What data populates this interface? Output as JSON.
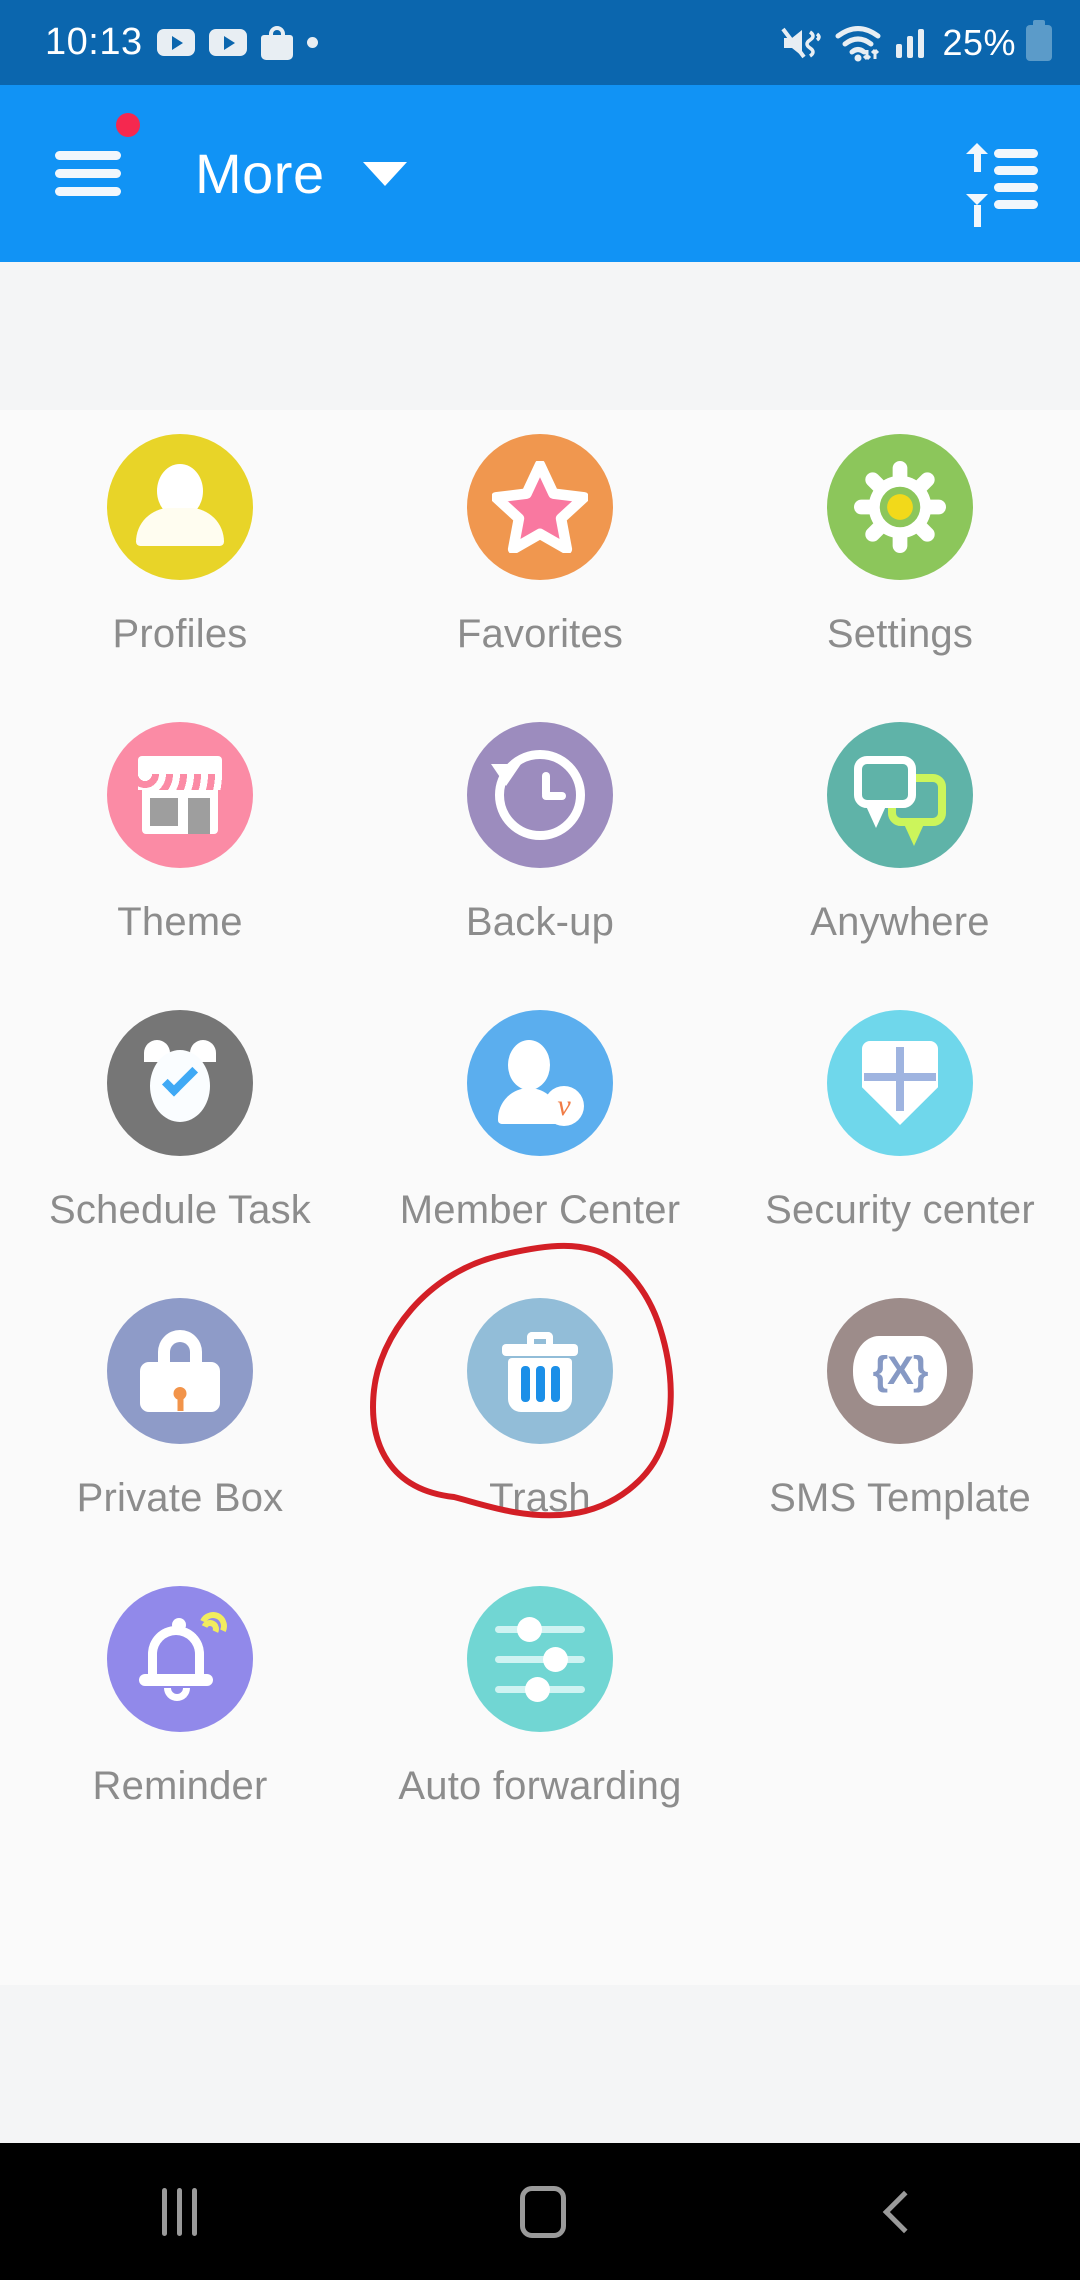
{
  "status_bar": {
    "time": "10:13",
    "battery_percent": "25%",
    "icons": [
      "youtube-play-icon",
      "youtube-play-icon",
      "shopping-bag-icon",
      "notification-dot-icon",
      "mute-vibrate-icon",
      "wifi-icon",
      "signal-bars-icon",
      "battery-icon"
    ],
    "background_color": "#0B66AE"
  },
  "app_bar": {
    "title": "More",
    "menu_icon": "hamburger-menu-icon",
    "has_badge": true,
    "dropdown_icon": "chevron-down-icon",
    "sort_icon": "sort-list-icon",
    "background_color": "#1193F5"
  },
  "grid": {
    "items": [
      {
        "label": "Profiles",
        "icon": "person-icon",
        "color": "#E8D428"
      },
      {
        "label": "Favorites",
        "icon": "star-icon",
        "color": "#F0974F"
      },
      {
        "label": "Settings",
        "icon": "gear-icon",
        "color": "#8CC65B"
      },
      {
        "label": "Theme",
        "icon": "storefront-icon",
        "color": "#FB8BA5"
      },
      {
        "label": "Back-up",
        "icon": "clock-restore-icon",
        "color": "#9C8CBE"
      },
      {
        "label": "Anywhere",
        "icon": "chat-bubbles-icon",
        "color": "#5FB3A8"
      },
      {
        "label": "Schedule Task",
        "icon": "alarm-clock-icon",
        "color": "#767676"
      },
      {
        "label": "Member Center",
        "icon": "member-badge-icon",
        "color": "#5BAEEE"
      },
      {
        "label": "Security center",
        "icon": "shield-icon",
        "color": "#6FD7EB"
      },
      {
        "label": "Private Box",
        "icon": "padlock-icon",
        "color": "#8E9BC8"
      },
      {
        "label": "Trash",
        "icon": "trash-can-icon",
        "color": "#92BDD8"
      },
      {
        "label": "SMS Template",
        "icon": "braces-x-icon",
        "color": "#9D8C8A"
      },
      {
        "label": "Reminder",
        "icon": "bell-icon",
        "color": "#9189EA"
      },
      {
        "label": "Auto forwarding",
        "icon": "sliders-icon",
        "color": "#71D6D3"
      }
    ]
  },
  "annotation": {
    "type": "hand-drawn-circle",
    "target_label": "Trash",
    "color": "#D31F26"
  },
  "nav_bar": {
    "recents_label": "Recents",
    "home_label": "Home",
    "back_label": "Back",
    "background_color": "#000000"
  }
}
